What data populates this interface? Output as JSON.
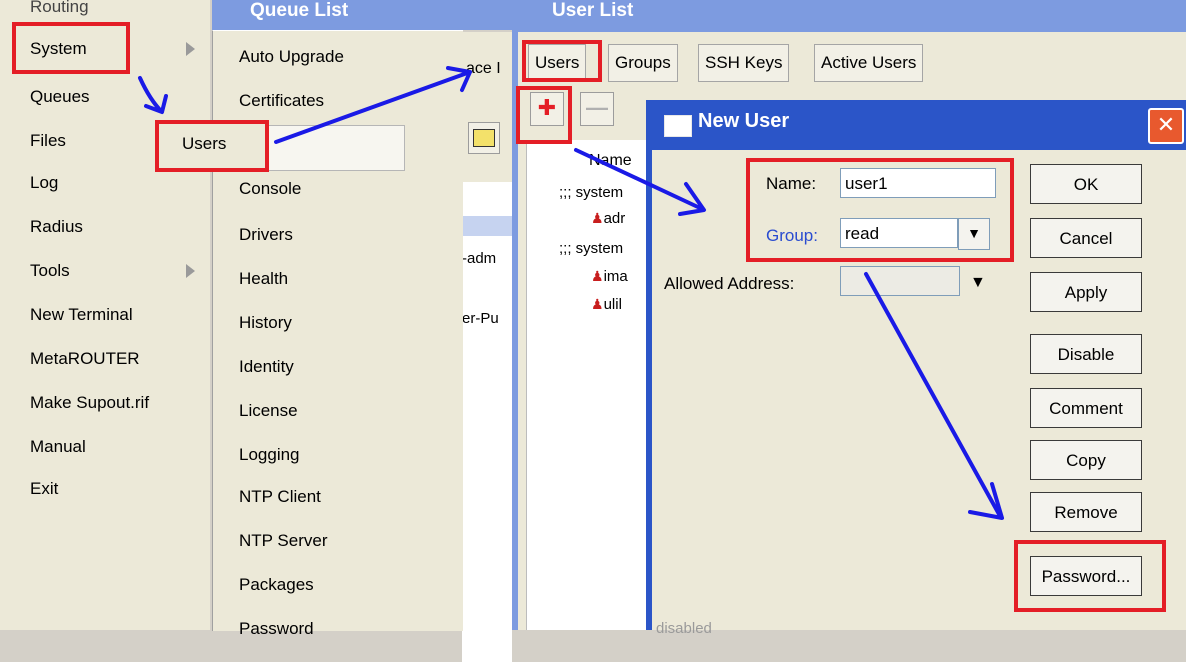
{
  "colors": {
    "highlight": "#e41e26",
    "arrow": "#1a1ae6",
    "window_blue": "#2b55c8"
  },
  "left_menu": {
    "items": [
      "System",
      "Queues",
      "Files",
      "Log",
      "Radius",
      "Tools",
      "New Terminal",
      "MetaROUTER",
      "Make Supout.rif",
      "Manual",
      "Exit"
    ]
  },
  "submenu": {
    "items": [
      "Auto Upgrade",
      "Certificates",
      "Users",
      "Console",
      "Drivers",
      "Health",
      "History",
      "Identity",
      "License",
      "Logging",
      "NTP Client",
      "NTP Server",
      "Packages",
      "Password"
    ]
  },
  "queue_window": {
    "title": "Queue List",
    "tab_fragment": "ace I"
  },
  "user_window": {
    "title": "User List",
    "tabs": [
      "Users",
      "Groups",
      "SSH Keys",
      "Active Users"
    ],
    "list": {
      "column": "Name",
      "rows": [
        ";;; system",
        "adr",
        ";;; system",
        "ima",
        "ulil"
      ],
      "fragments": [
        "-adm",
        "er-Pu"
      ]
    }
  },
  "dialog": {
    "title": "New User",
    "name_label": "Name:",
    "name_value": "user1",
    "group_label": "Group:",
    "group_value": "read",
    "allowed_label": "Allowed Address:",
    "buttons": [
      "OK",
      "Cancel",
      "Apply",
      "Disable",
      "Comment",
      "Copy",
      "Remove",
      "Password..."
    ],
    "status": "disabled"
  }
}
